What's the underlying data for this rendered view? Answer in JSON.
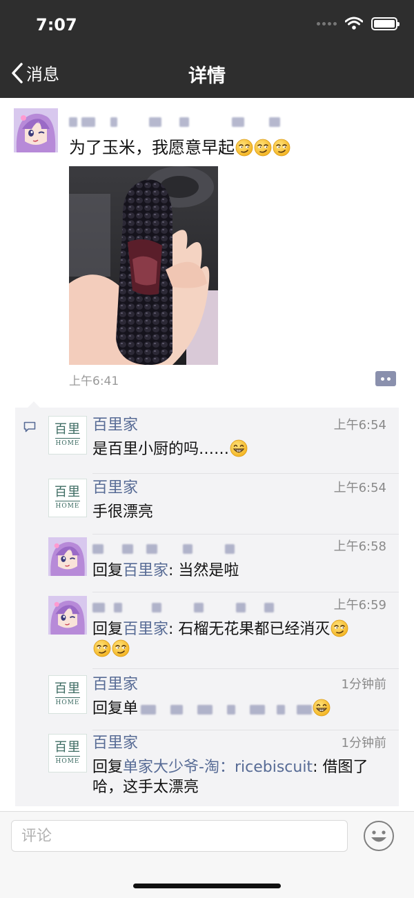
{
  "status_bar": {
    "time": "7:07"
  },
  "nav": {
    "back_label": "消息",
    "title": "详情"
  },
  "post": {
    "text": "为了玉米，我愿意早起",
    "emojis": [
      "smirk-emoji",
      "smirk-emoji",
      "smirk-emoji"
    ],
    "photo": "hand-holding-purple-corn",
    "time": "上午6:41"
  },
  "comments": [
    {
      "author": "百里家",
      "time": "上午6:54",
      "text": "是百里小厨的吗……",
      "emoji": "grin-emoji",
      "avatar": "brand"
    },
    {
      "author": "百里家",
      "time": "上午6:54",
      "text": "手很漂亮",
      "avatar": "brand"
    },
    {
      "author_blurred": true,
      "time": "上午6:58",
      "reply_prefix": "回复",
      "reply_to": "百里家",
      "text": ": 当然是啦",
      "avatar": "anime"
    },
    {
      "author_blurred": true,
      "time": "上午6:59",
      "reply_prefix": "回复",
      "reply_to": "百里家",
      "text": ": 石榴无花果都已经消灭",
      "emoji": "smirk-emoji",
      "avatar": "anime"
    },
    {
      "author": "百里家",
      "time": "1分钟前",
      "reply_prefix": "回复单",
      "text_blurred": true,
      "emoji": "grin-emoji",
      "avatar": "brand"
    },
    {
      "author": "百里家",
      "time": "1分钟前",
      "reply_prefix": "回复",
      "reply_to": "单家大少爷-淘：ricebiscuit",
      "text": ": 借图了哈，这手太漂亮",
      "avatar": "brand"
    }
  ],
  "brand_avatar": {
    "cn": "百里",
    "en": "HOME"
  },
  "bottom": {
    "comment_placeholder": "评论"
  }
}
